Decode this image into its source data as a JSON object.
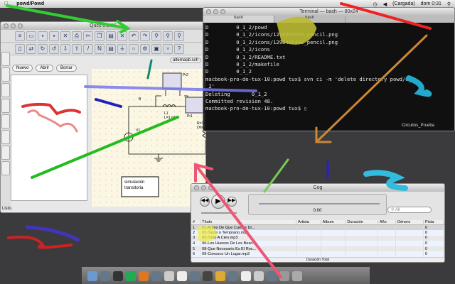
{
  "menubar": {
    "app_name": "powd/Powd",
    "battery": "(Cargada)",
    "clock": "dom 0:31"
  },
  "qucs": {
    "title": "Qucs 0.0.15",
    "buttons": [
      "Nuevo",
      "Abrir",
      "Borrar"
    ],
    "tab": "alternaob.sch",
    "status": "Listo.",
    "schematic": {
      "pr2": "Pr2",
      "pr1": "Pr1",
      "l1": "L1",
      "l1_val": "L=1 mH",
      "v1": "V1",
      "r1": "R=10 Ohm",
      "node": "B",
      "sim": "simulación transitoria"
    }
  },
  "terminal": {
    "title": "Terminal — bash — 80x24",
    "tabs": [
      "bash",
      "bash"
    ],
    "lines": [
      "D         0_1_2/powd",
      "D         0_1_2/icons/1298465688_pencil.png",
      "D         0_1_2/icons/1298465440_pencil.png",
      "D         0_1_2/icons",
      "D         0_1_2/README.txt",
      "D         0_1_2/makefile",
      "D         0_1_2",
      "macbook-pro-de-tux-10:powd tux$ svn ci -m 'delete directory powd/0_1",
      "_2'",
      "Deleting       0_1_2",
      "",
      "Committed revision 48.",
      "macbook-pro-de-tux-10:powd tux$ ▯"
    ],
    "desktop_folder": "Circuitos_Prueba"
  },
  "cog": {
    "title": "Cog",
    "time": "0:00",
    "search_placeholder": "All",
    "columns": [
      "#",
      "Título",
      "Artista",
      "Álbum",
      "Duración",
      "Año",
      "Género",
      "Pista"
    ],
    "rows": [
      [
        "1",
        "01-Antes De Que Cuente Di...",
        "0"
      ],
      [
        "2",
        "03-Tarde o Temprano.mp3",
        "0"
      ],
      [
        "3",
        "05-Todo A Cien.mp3",
        "0"
      ],
      [
        "4",
        "06-Los Huesos De Los Beso...",
        "0"
      ],
      [
        "5",
        "08-Que Necesario Es El Roc...",
        "0"
      ],
      [
        "6",
        "09-Conozco Un Lugar.mp3",
        "0"
      ]
    ],
    "footer": "Duración Total"
  }
}
